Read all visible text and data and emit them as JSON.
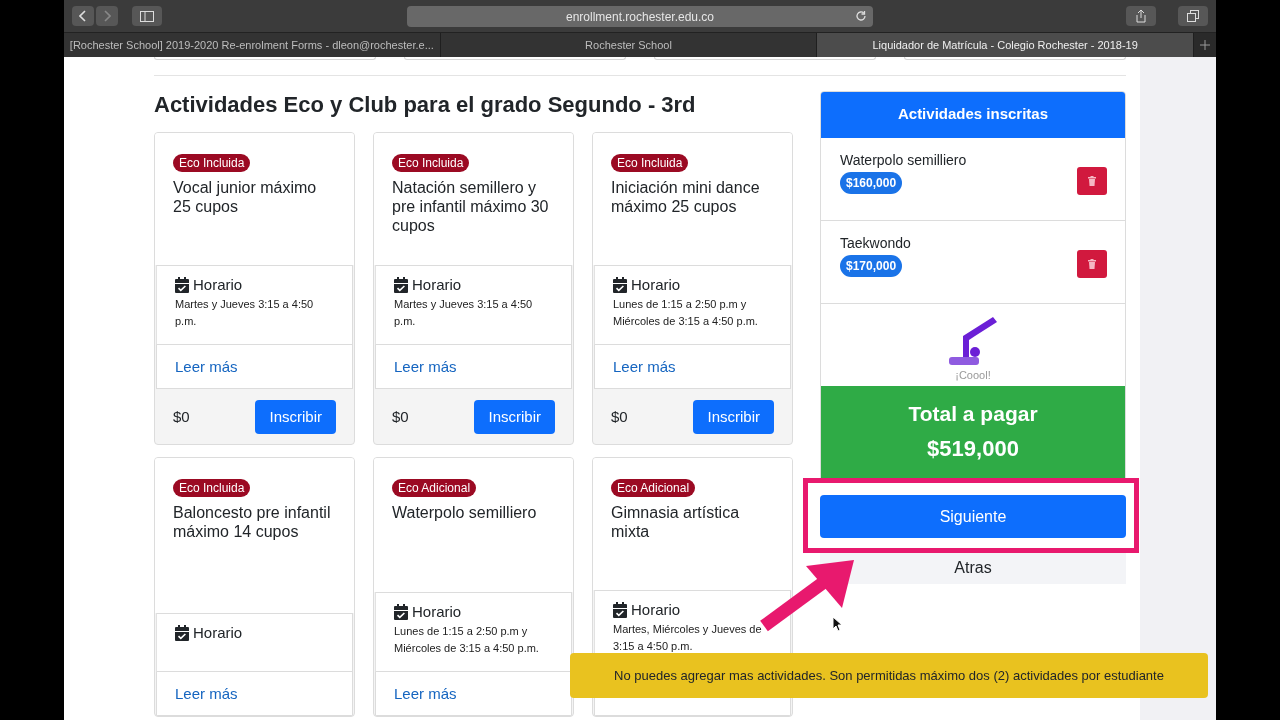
{
  "browser": {
    "url": "enrollment.rochester.edu.co",
    "tabs": [
      {
        "label": "[Rochester School] 2019-2020 Re-enrolment Forms - dleon@rochester.e...",
        "selected": false
      },
      {
        "label": "Rochester School",
        "selected": false
      },
      {
        "label": "Liquidador de Matrícula - Colegio Rochester - 2018-19",
        "selected": true
      }
    ]
  },
  "heading": "Actividades Eco y Club para el grado Segundo - 3rd",
  "activities": [
    {
      "badge": "Eco Incluida",
      "title": "Vocal junior máximo 25 cupos",
      "schedule_label": "Horario",
      "schedule": "Martes y Jueves 3:15 a 4:50 p.m.",
      "link": "Leer más",
      "price": "$0",
      "button": "Inscribir"
    },
    {
      "badge": "Eco Incluida",
      "title": "Natación semillero y pre infantil máximo 30 cupos",
      "schedule_label": "Horario",
      "schedule": "Martes y Jueves 3:15 a 4:50 p.m.",
      "link": "Leer más",
      "price": "$0",
      "button": "Inscribir"
    },
    {
      "badge": "Eco Incluida",
      "title": "Iniciación mini dance máximo 25 cupos",
      "schedule_label": "Horario",
      "schedule": "Lunes de 1:15 a 2:50 p.m y Miércoles de 3:15 a 4:50 p.m.",
      "link": "Leer más",
      "price": "$0",
      "button": "Inscribir"
    },
    {
      "badge": "Eco Incluida",
      "title": "Baloncesto pre infantil máximo 14 cupos",
      "schedule_label": "Horario",
      "link": "Leer más"
    },
    {
      "badge": "Eco Adicional",
      "title": "Waterpolo semilliero",
      "schedule_label": "Horario",
      "schedule": "Lunes de 1:15 a 2:50 p.m y Miércoles de 3:15 a 4:50 p.m.",
      "link": "Leer más"
    },
    {
      "badge": "Eco Adicional",
      "title": "Gimnasia artística mixta",
      "schedule_label": "Horario",
      "schedule": "Martes, Miércoles y Jueves de 3:15 a 4:50 p.m."
    }
  ],
  "enrolled": {
    "title": "Actividades inscritas",
    "items": [
      {
        "name": "Waterpolo semilliero",
        "price": "$160,000"
      },
      {
        "name": "Taekwondo",
        "price": "$170,000"
      }
    ],
    "caption": "¡Coool!",
    "total_label": "Total a pagar",
    "total": "$519,000",
    "next_button": "Siguiente",
    "back_button": "Atras"
  },
  "toast": "No puedes agregar mas actividades. Son permitidas máximo dos (2) actividades por estudiante"
}
